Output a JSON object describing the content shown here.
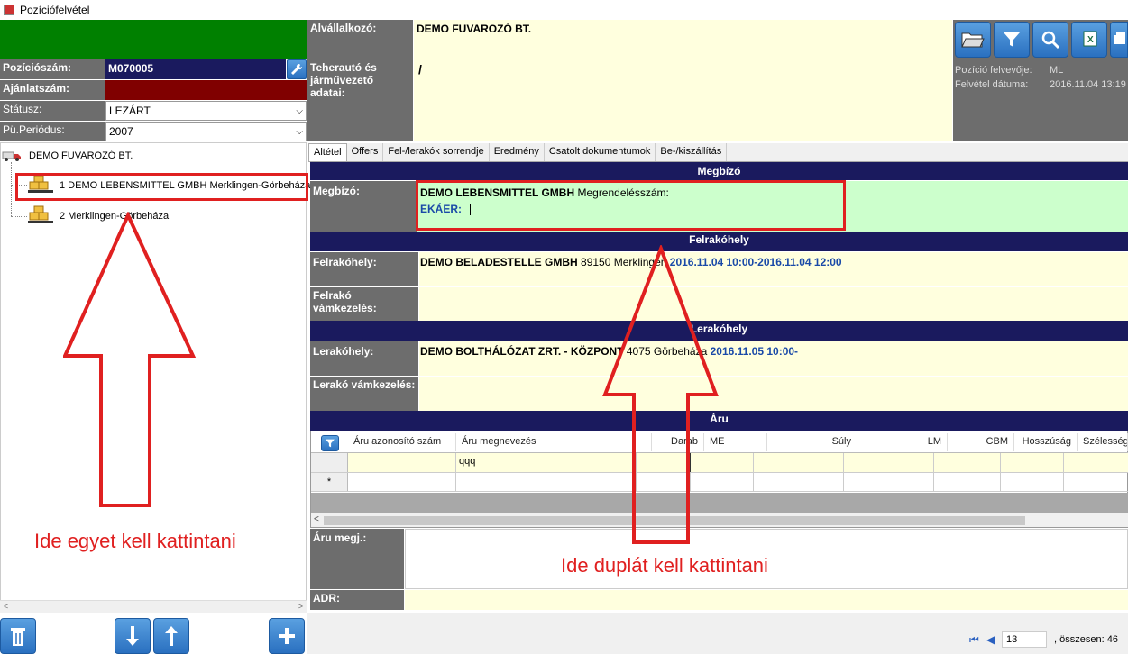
{
  "window": {
    "title": "Pozíciófelvétel"
  },
  "header": {
    "pozicioszam_label": "Pozíciószám:",
    "pozicioszam_value": "M070005",
    "ajanlatszam_label": "Ajánlatszám:",
    "statusz_label": "Státusz:",
    "statusz_value": "LEZÁRT",
    "periodus_label": "Pü.Periódus:",
    "periodus_value": "2007",
    "alvallalkozo_label": "Alvállalkozó:",
    "alvallalkozo_value": "DEMO FUVAROZÓ BT.",
    "teherauto_label": "Teherautó és járművezető adatai:",
    "teherauto_value": "/",
    "felvevo_label": "Pozíció felvevője:",
    "felvevo_value": "ML",
    "datum_label": "Felvétel dátuma:",
    "datum_value": "2016.11.04 13:19"
  },
  "tree": {
    "root": "DEMO FUVAROZÓ BT.",
    "items": [
      "1 DEMO LEBENSMITTEL GMBH Merklingen-Görbeháza",
      "2  Merklingen-Görbeháza"
    ]
  },
  "tabs": [
    "Altétel",
    "Offers",
    "Fel-/lerakók sorrendje",
    "Eredmény",
    "Csatolt dokumentumok",
    "Be-/kiszállítás"
  ],
  "sections": {
    "megbizo": "Megbízó",
    "felrakohely": "Felrakóhely",
    "lerakohely": "Lerakóhely",
    "aru": "Áru"
  },
  "megbizo": {
    "label": "Megbízó:",
    "company": "DEMO LEBENSMITTEL GMBH",
    "order_label": "Megrendelésszám:",
    "ekaer_label": "EKÁER:"
  },
  "felrako": {
    "label": "Felrakóhely:",
    "company": "DEMO BELADESTELLE GMBH",
    "place": "89150 Merklingen",
    "time": "2016.11.04 10:00-2016.11.04 12:00",
    "vam_label": "Felrakó vámkezelés:"
  },
  "lerako": {
    "label": "Lerakóhely:",
    "company": "DEMO BOLTHÁLÓZAT ZRT. - KÖZPONT",
    "place": "4075 Görbeháza",
    "time": "2016.11.05 10:00-",
    "vam_label": "Lerakó vámkezelés:"
  },
  "grid": {
    "columns": [
      "Áru azonosító szám",
      "Áru megnevezés",
      "Darab",
      "ME",
      "Súly",
      "LM",
      "CBM",
      "Hosszúság",
      "Szélesség"
    ],
    "row1_name": "qqq",
    "new_row_marker": "*"
  },
  "aru_megj_label": "Áru megj.:",
  "adr_label": "ADR:",
  "pager": {
    "current": "13",
    "total_label": ", összesen: 46"
  },
  "annotations": {
    "left": "Ide egyet kell kattintani",
    "right": "Ide duplát kell kattintani"
  },
  "colors": {
    "navy": "#1a1a5e",
    "yellow": "#ffffde",
    "green_header": "#008000",
    "red_field": "#800000",
    "annotation": "#e02020"
  }
}
